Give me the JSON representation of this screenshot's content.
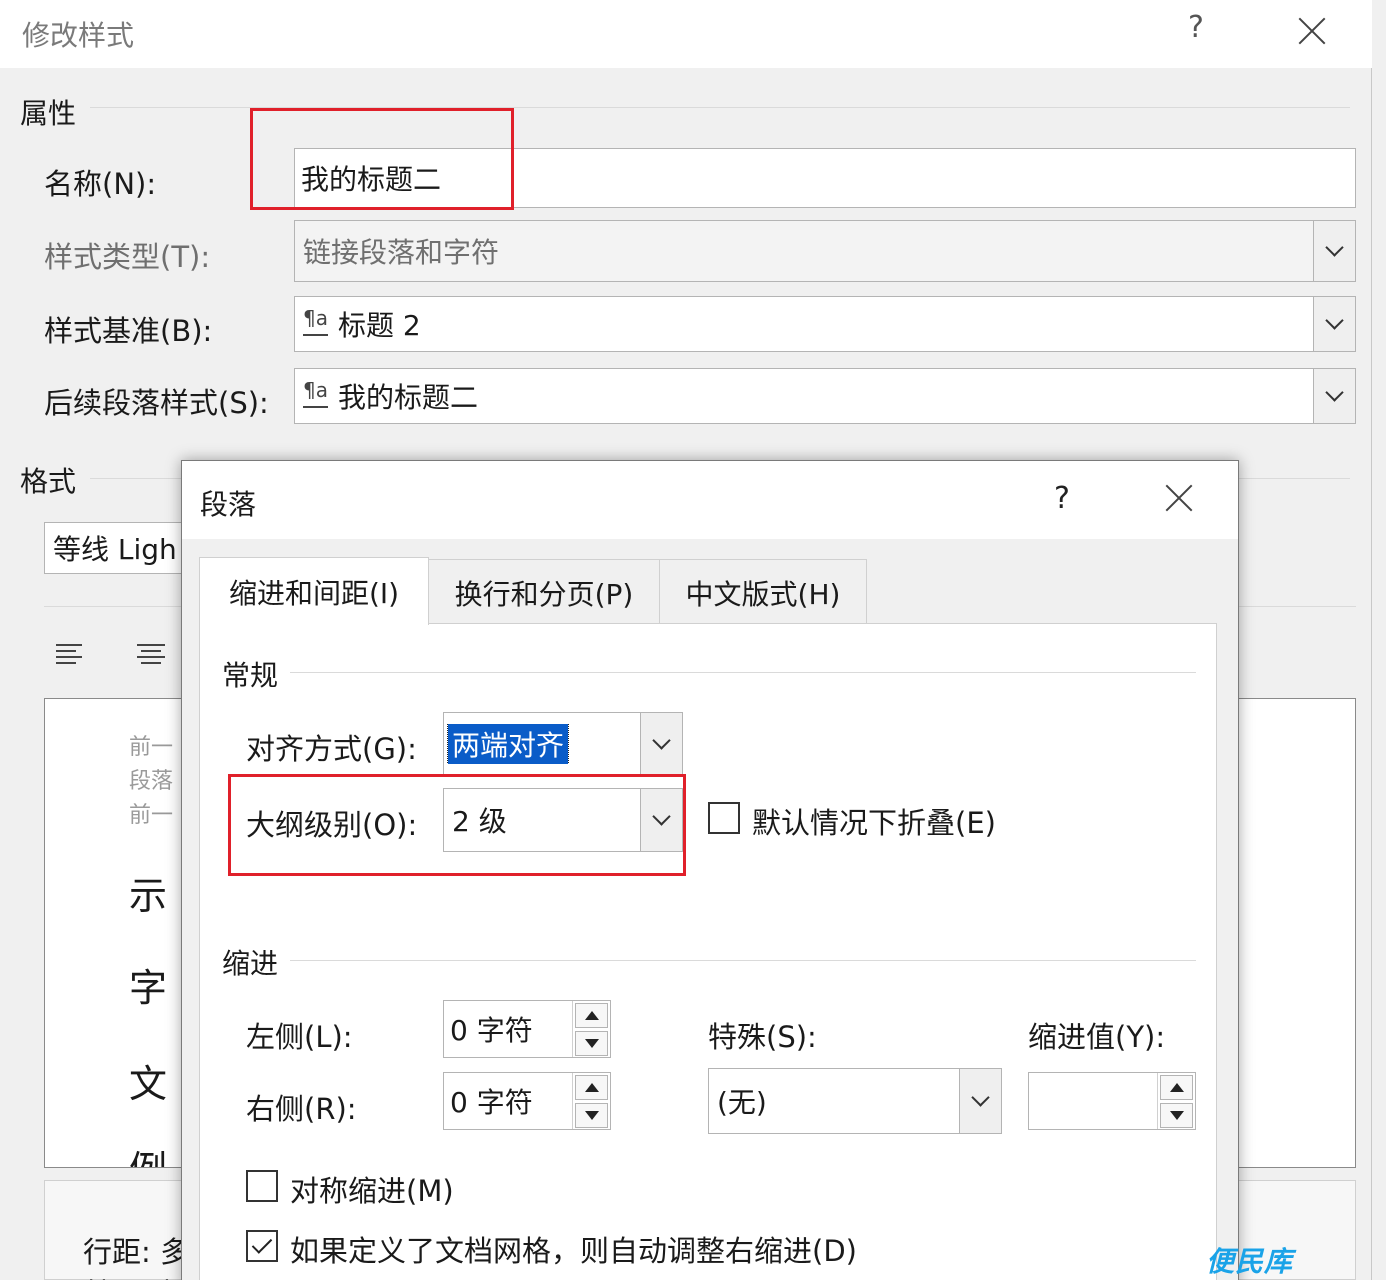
{
  "modify_style": {
    "title": "修改样式",
    "help": "?",
    "properties_section": "属性",
    "name_label": "名称(N):",
    "name_value": "我的标题二",
    "style_type_label": "样式类型(T):",
    "style_type_value": "链接段落和字符",
    "based_on_label": "样式基准(B):",
    "based_on_value": "标题 2",
    "next_style_label": "后续段落样式(S):",
    "next_style_value": "我的标题二",
    "style_glyph": "¶a",
    "format_section": "格式",
    "font_value": "等线 Ligh",
    "preview_small_lines": [
      "前一",
      "段落",
      "前一"
    ],
    "preview_large_lines": [
      "示",
      "字",
      "文",
      "例"
    ],
    "line_spacing_text": "行距: 多",
    "below_text": "基于: 标"
  },
  "paragraph": {
    "title": "段落",
    "help": "?",
    "tabs": [
      {
        "label": "缩进和间距(I)",
        "active": true
      },
      {
        "label": "换行和分页(P)",
        "active": false
      },
      {
        "label": "中文版式(H)",
        "active": false
      }
    ],
    "general_section": "常规",
    "alignment_label": "对齐方式(G):",
    "alignment_value": "两端对齐",
    "outline_label": "大纲级别(O):",
    "outline_value": "2 级",
    "collapse_label": "默认情况下折叠(E)",
    "indent_section": "缩进",
    "left_label": "左侧(L):",
    "left_value": "0 字符",
    "right_label": "右侧(R):",
    "right_value": "0 字符",
    "special_label": "特殊(S):",
    "special_value": "(无)",
    "indent_value_label": "缩进值(Y):",
    "indent_value": "",
    "mirror_label": "对称缩进(M)",
    "grid_label": "如果定义了文档网格，则自动调整右缩进(D)"
  },
  "watermark": "便民库",
  "colors": {
    "highlight_box": "#e0202a",
    "selection": "#0a5cc8",
    "watermark": "#1aa3e8"
  }
}
